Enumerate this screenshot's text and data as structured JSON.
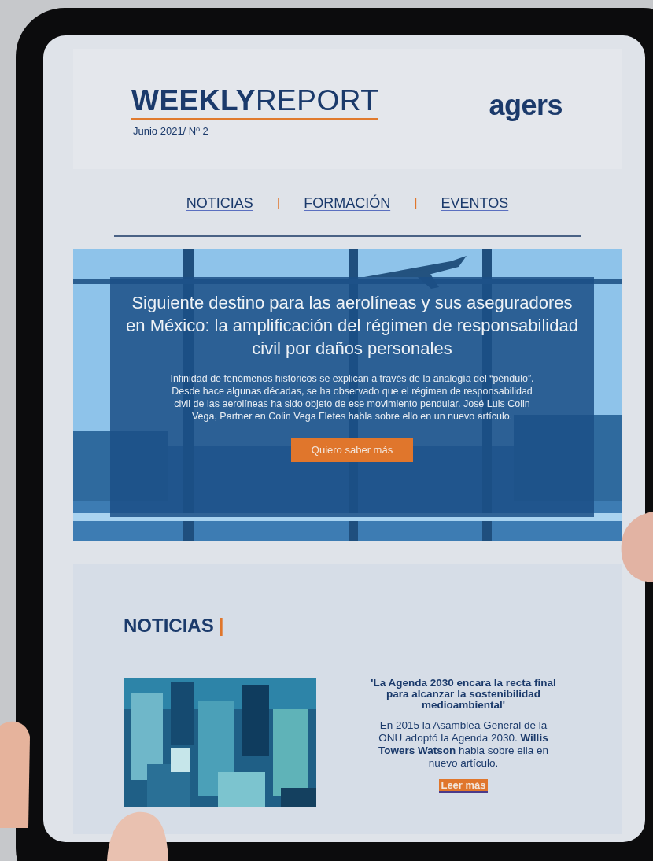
{
  "header": {
    "title": "**WEEKLY**REPORT",
    "issue": "Junio 2021/ Nº 2",
    "logo": "agers"
  },
  "nav": [
    {
      "label": "NOTICIAS"
    },
    {
      "label": "FORMACIÓN"
    },
    {
      "label": "EVENTOS"
    }
  ],
  "nav_separator": "|",
  "hero": {
    "title": "Siguiente destino para las aerolíneas y sus aseguradores en México: la amplificación del régimen de responsabilidad civil por daños personales",
    "body": "Infinidad de fenómenos históricos se explican a través de la analogía del “péndulo”. Desde hace algunas décadas, se ha observado que el régimen de responsabilidad civil de las aerolíneas ha sido objeto de ese movimiento pendular. José Luis Colin Vega, Partner en Colin Vega Fletes habla sobre ello en un nuevo artículo.",
    "button": "Quiero saber más"
  },
  "news": {
    "heading": "NOTICIAS",
    "heading_mark": "|",
    "article": {
      "title": "'La Agenda 2030 encara la recta final para alcanzar la sostenibilidad medioambiental'",
      "body": "En 2015 la Asamblea General de la ONU adoptó la Agenda 2030. **Willis Towers Watson** habla sobre ella en nuevo artículo.",
      "link": "Leer más"
    }
  }
}
